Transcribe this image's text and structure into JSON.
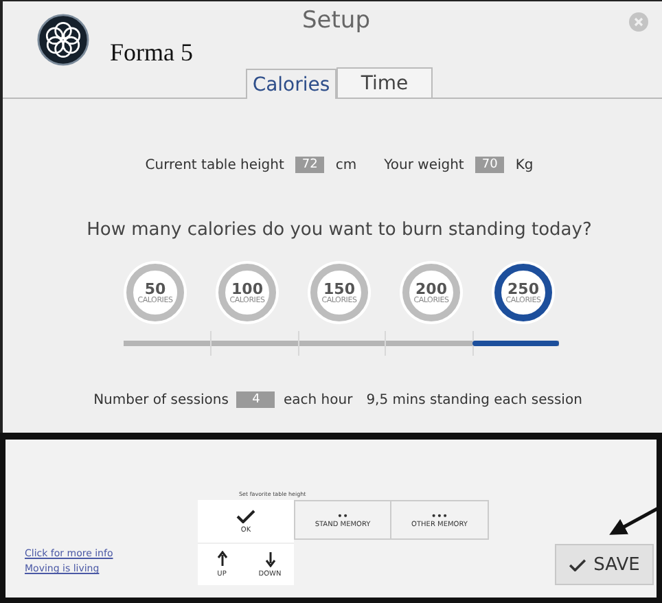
{
  "brand": {
    "name": "Forma 5"
  },
  "window": {
    "title": "Setup"
  },
  "tabs": [
    {
      "label": "Calories",
      "selected": true
    },
    {
      "label": "Time",
      "selected": false
    }
  ],
  "fields": [
    {
      "label": "Current table height",
      "value": "72",
      "unit": "cm"
    },
    {
      "label": "Your weight",
      "value": "70",
      "unit": "Kg"
    }
  ],
  "question": "How many calories do you want to burn standing today?",
  "calorie_options": [
    {
      "value": "50",
      "unit": "CALORIES",
      "selected": false
    },
    {
      "value": "100",
      "unit": "CALORIES",
      "selected": false
    },
    {
      "value": "150",
      "unit": "CALORIES",
      "selected": false
    },
    {
      "value": "200",
      "unit": "CALORIES",
      "selected": false
    },
    {
      "value": "250",
      "unit": "CALORIES",
      "selected": true
    }
  ],
  "sessions": {
    "label": "Number of sessions",
    "value": "4",
    "after": "each hour",
    "note": "9,5 mins standing each session"
  },
  "keypad": {
    "caption": "Set favorite table height",
    "ok": "OK",
    "up": "UP",
    "down": "DOWN"
  },
  "memory_buttons": [
    {
      "dots": "••",
      "label": "STAND MEMORY"
    },
    {
      "dots": "•••",
      "label": "OTHER MEMORY"
    }
  ],
  "links": [
    "Click for more info",
    "Moving is living"
  ],
  "save_button": "SAVE"
}
